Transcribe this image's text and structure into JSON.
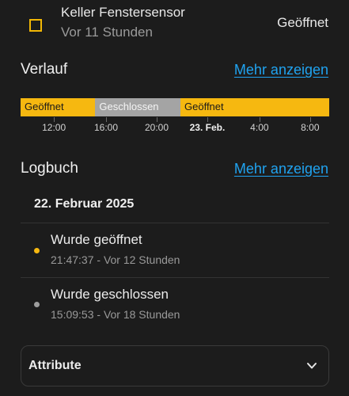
{
  "entity": {
    "name": "Keller Fenstersensor",
    "last_changed": "Vor 11 Stunden",
    "state": "Geöffnet",
    "icon": "square-outline-icon"
  },
  "history": {
    "title": "Verlauf",
    "more_label": "Mehr anzeigen",
    "segments": [
      {
        "label": "Geöffnet",
        "state": "open",
        "share": 0.242
      },
      {
        "label": "Geschlossen",
        "state": "closed",
        "share": 0.276
      },
      {
        "label": "Geöffnet",
        "state": "open",
        "share": 0.482
      }
    ],
    "ticks": [
      {
        "label": "12:00",
        "bold": false,
        "pos": 0.108
      },
      {
        "label": "16:00",
        "bold": false,
        "pos": 0.277
      },
      {
        "label": "20:00",
        "bold": false,
        "pos": 0.441
      },
      {
        "label": "23. Feb.",
        "bold": true,
        "pos": 0.605
      },
      {
        "label": "4:00",
        "bold": false,
        "pos": 0.774
      },
      {
        "label": "8:00",
        "bold": false,
        "pos": 0.938
      }
    ]
  },
  "logbook": {
    "title": "Logbuch",
    "more_label": "Mehr anzeigen",
    "date": "22. Februar 2025",
    "entries": [
      {
        "title": "Wurde geöffnet",
        "time": "21:47:37 - Vor 12 Stunden",
        "color": "#f6b810"
      },
      {
        "title": "Wurde geschlossen",
        "time": "15:09:53 - Vor 18 Stunden",
        "color": "#9e9e9e"
      }
    ]
  },
  "attributes": {
    "label": "Attribute"
  },
  "colors": {
    "open": "#f6b810",
    "closed": "#a4a4a4",
    "link": "#20a3f0",
    "background": "#1c1c1c"
  }
}
